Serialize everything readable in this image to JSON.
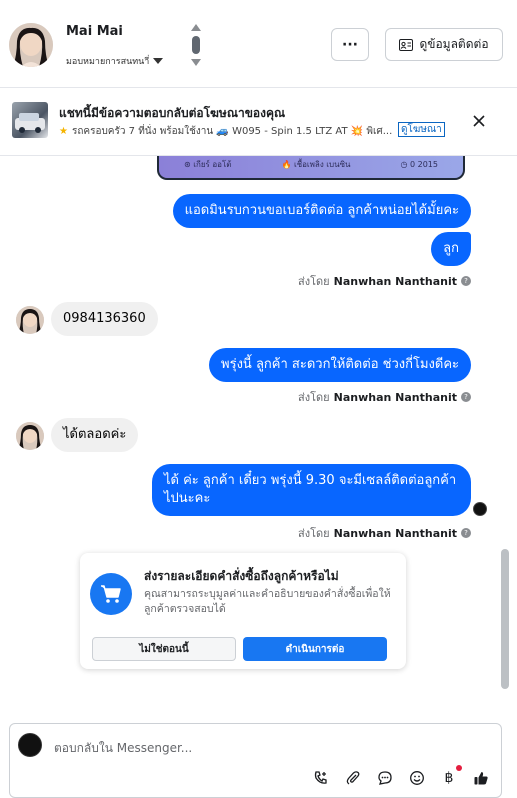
{
  "header": {
    "name": "Mai Mai",
    "assign_label": "มอบหมายการสนทนาี่",
    "more_label": "···",
    "contact_btn": "ดูข้อมูลติดต่อ"
  },
  "ad": {
    "title": "แชทนี้มีข้อความตอบกลับต่อโฆษณาของคุณ",
    "subtitle": "รถครอบครัว 7 ที่นั่ง พร้อมใช้งาน 🚙 W095 - Spin 1.5 LTZ AT 💥 พิเศ...",
    "link": "ดูโฆษณา"
  },
  "media_card": {
    "items": [
      "⊛ เกียร์ ออโต้",
      "🔥 เชื้อเพลิง เบนซิน",
      "◷ 0 2015"
    ]
  },
  "messages": {
    "m1": "แอดมินรบกวนขอเบอร์ติดต่อ ลูกค้าหน่อยได้มั้ยคะ",
    "m2": "ลูก",
    "sent_by_1": "ส่งโดย",
    "sender_1": "Nanwhan Nanthanit",
    "m3": "0984136360",
    "m4": "พรุ่งนี้ ลูกค้า สะดวกให้ติดต่อ ช่วงกี่โมงดีคะ",
    "sent_by_2": "ส่งโดย",
    "sender_2": "Nanwhan Nanthanit",
    "m5": "ได้ตลอดค่ะ",
    "m6": "ได้ ค่ะ  ลูกค้า เดี๋ยว พรุ่งนี้  9.30 จะมีเซลล์ติดต่อลูกค้าไปนะคะ",
    "sent_by_3": "ส่งโดย",
    "sender_3": "Nanwhan Nanthanit"
  },
  "suggestion": {
    "title": "ส่งรายละเอียดคำสั่งซื้อถึงลูกค้าหรือไม่",
    "desc": "คุณสามารถระบุมูลค่าและคำอธิบายของคำสั่งซื้อเพื่อให้ลูกค้าตรวจสอบได้",
    "no_label": "ไม่ใช่ตอนนี้",
    "yes_label": "ดำเนินการต่อ"
  },
  "composer": {
    "placeholder": "ตอบกลับใน Messenger..."
  },
  "colors": {
    "brand_blue": "#0866ff",
    "bubble_gray": "#f0f0f0"
  }
}
